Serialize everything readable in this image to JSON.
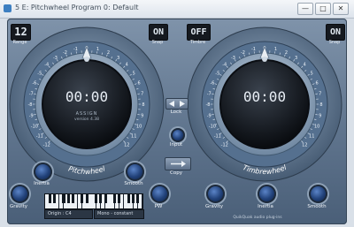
{
  "window": {
    "title": "5 E: Pitchwheel Program 0: Default",
    "buttons": {
      "minimize": "—",
      "maximize": "□",
      "close": "✕"
    }
  },
  "left": {
    "range": {
      "value": "12",
      "label": "Range"
    },
    "snap": {
      "value": "ON",
      "label": "Snap"
    },
    "time": "00:00",
    "brand": "ASSIGN",
    "version": "version 4.38",
    "ring_label": "Pitchwheel",
    "knobs": {
      "inertia": "Inertia",
      "smooth": "Smooth",
      "gravity": "Gravity",
      "pw": "PW"
    },
    "keyboard": {
      "origin": "Origin : C4",
      "mode": "Mono - constant"
    }
  },
  "right": {
    "timbre": {
      "value": "OFF",
      "label": "Timbre"
    },
    "snap": {
      "value": "ON",
      "label": "Snap"
    },
    "time": "00:00",
    "ring_label": "Timbrewheel",
    "knobs": {
      "gravity": "Gravity",
      "inertia": "Inertia",
      "smooth": "Smooth"
    },
    "credit": "QuikQuak audio plug-ins"
  },
  "center": {
    "lock": "Lock",
    "input": "Input",
    "copy": "Copy"
  },
  "scale_labels": [
    "0",
    "1",
    "2",
    "3",
    "4",
    "5",
    "6",
    "7",
    "8",
    "9",
    "10",
    "11",
    "12",
    "-1",
    "-2",
    "-3",
    "-4",
    "-5",
    "-6",
    "-7",
    "-8",
    "-9",
    "-10",
    "-11",
    "-12"
  ],
  "colors": {
    "panel": "#6b8098",
    "knob": "#2a4f8c",
    "lcd": "#15191f"
  }
}
